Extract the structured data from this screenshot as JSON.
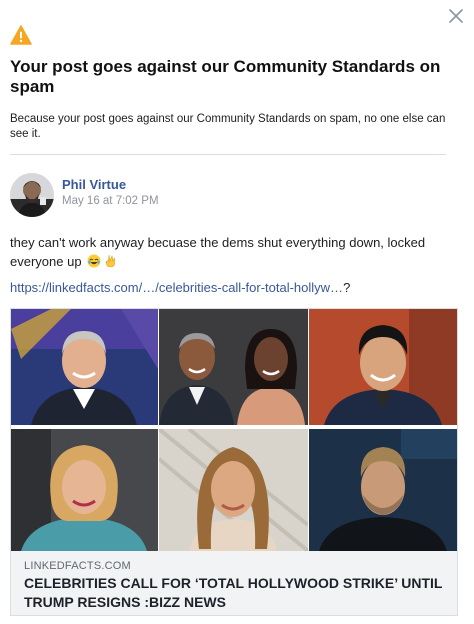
{
  "dialog": {
    "close_icon": "close-x-icon",
    "warning_icon": "warning-triangle-icon",
    "title": "Your post goes against our Community Standards on spam",
    "subtitle": "Because your post goes against our Community Standards on spam, no one else can see it."
  },
  "post": {
    "author": "Phil Virtue",
    "timestamp": "May 16 at 7:02 PM",
    "text": "they can't work anyway becuase the dems shut everything down, locked everyone up",
    "emojis": [
      "rolling-laughing-emoji",
      "ok-hand-emoji"
    ],
    "link_text": "https://linkedfacts.com/…/celebrities-call-for-total-hollyw…",
    "link_suffix": "?"
  },
  "preview": {
    "domain": "LINKEDFACTS.COM",
    "title": "CELEBRITIES CALL FOR ‘TOTAL HOLLYWOOD STRIKE’ UNTIL TRUMP RESIGNS :BIZZ NEWS"
  },
  "colors": {
    "warning": "#f5a623",
    "link": "#385898",
    "meta": "#90949c"
  }
}
